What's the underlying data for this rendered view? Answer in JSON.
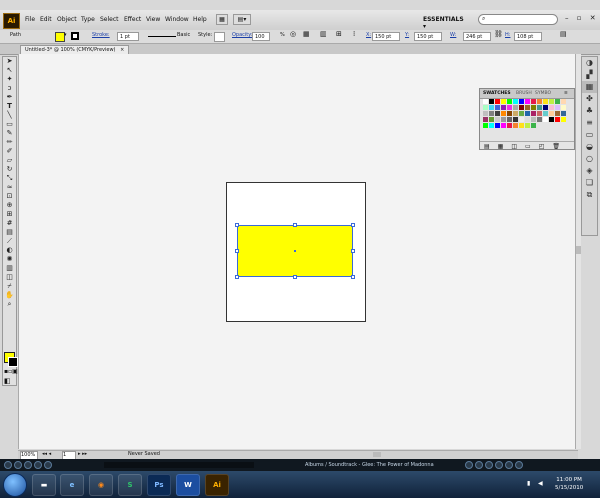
{
  "app": {
    "logo": "Ai"
  },
  "menu": [
    "File",
    "Edit",
    "Object",
    "Type",
    "Select",
    "Effect",
    "View",
    "Window",
    "Help"
  ],
  "workspace": {
    "label": "ESSENTIALS ▾"
  },
  "control": {
    "selection": "Path",
    "stroke_label": "Stroke:",
    "stroke_weight": "1 pt",
    "brush": "Basic",
    "style_label": "Style:",
    "opacity_label": "Opacity:",
    "opacity": "100",
    "opacity_unit": "%",
    "x_label": "X:",
    "x": "150 pt",
    "y_label": "Y:",
    "y": "150 pt",
    "w_label": "W:",
    "w": "246 pt",
    "h_label": "H:",
    "h": "108 pt"
  },
  "document": {
    "tab": "Untitled-3* @ 100% (CMYK/Preview)"
  },
  "swatches_panel": {
    "tabs": [
      "SWATCHES",
      "BRUSH",
      "SYMBO"
    ]
  },
  "status": {
    "zoom": "100%",
    "artboard": "1",
    "state": "Never Saved"
  },
  "media": {
    "track": "Albums / Soundtrack - Glee: The Power of Madonna"
  },
  "taskbar": {
    "time": "11:00 PM",
    "date": "5/15/2010"
  },
  "colors": {
    "fill": "#ffff00",
    "selection": "#3a6ad8"
  }
}
